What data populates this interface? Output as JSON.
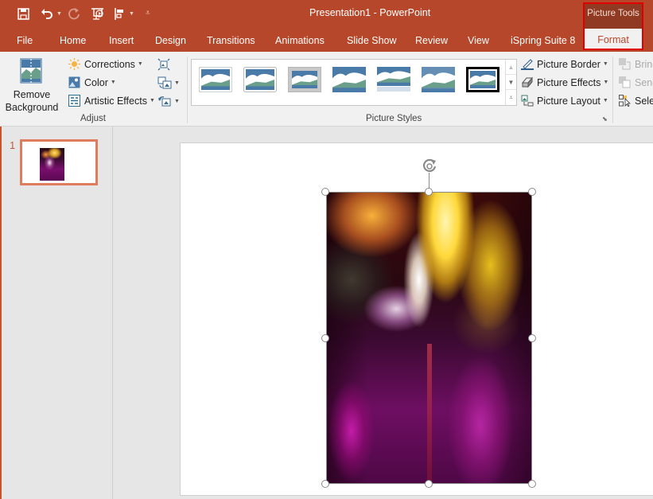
{
  "window": {
    "title": "Presentation1  -  PowerPoint",
    "context_header": "Picture Tools"
  },
  "quick_access": {
    "icons": [
      "save-icon",
      "undo-icon",
      "redo-icon",
      "start-from-beginning-icon",
      "align-icon",
      "customize-qat-icon"
    ]
  },
  "tabs": [
    {
      "label": "File"
    },
    {
      "label": "Home"
    },
    {
      "label": "Insert"
    },
    {
      "label": "Design"
    },
    {
      "label": "Transitions"
    },
    {
      "label": "Animations"
    },
    {
      "label": "Slide Show"
    },
    {
      "label": "Review"
    },
    {
      "label": "View"
    },
    {
      "label": "iSpring Suite 8"
    },
    {
      "label": "Format",
      "active": true
    }
  ],
  "ribbon": {
    "adjust": {
      "label": "Adjust",
      "remove_background_line1": "Remove",
      "remove_background_line2": "Background",
      "corrections": "Corrections",
      "color": "Color",
      "artistic_effects": "Artistic Effects",
      "icons": [
        "compress-pictures-icon",
        "change-picture-icon",
        "reset-picture-icon"
      ]
    },
    "picture_styles": {
      "label": "Picture Styles",
      "styles": [
        "Simple Frame, White",
        "Beveled Matte, White",
        "Metal Frame",
        "Drop Shadow Rectangle",
        "Reflected Rounded Rectangle",
        "Soft Edge Rectangle",
        "Double Frame, Black"
      ],
      "picture_border": "Picture Border",
      "picture_effects": "Picture Effects",
      "picture_layout": "Picture Layout"
    },
    "arrange": {
      "bring_forward": "Bring",
      "send_backward": "Send",
      "selection_pane": "Selec"
    }
  },
  "slides_panel": {
    "slides": [
      {
        "number": "1"
      }
    ]
  },
  "colors": {
    "accent": "#b7472a",
    "context_highlight": "#e00000",
    "thumb_border": "#e07c5e"
  }
}
